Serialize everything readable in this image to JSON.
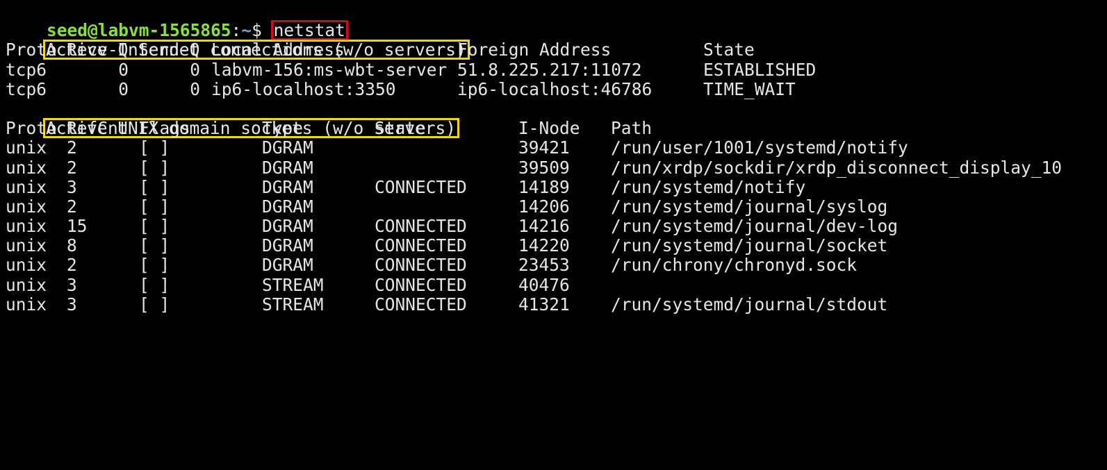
{
  "prompt": {
    "user_host": "seed@labvm-1565865",
    "separator": ":",
    "path": "~",
    "symbol": "$",
    "command": "netstat"
  },
  "inet": {
    "heading": "Active Internet connections (w/o servers)",
    "headers": [
      "Proto",
      "Recv-Q",
      "Send-Q",
      "Local Address",
      "Foreign Address",
      "State"
    ],
    "rows": [
      [
        "tcp6",
        "0",
        "0",
        "labvm-156:ms-wbt-server",
        "51.8.225.217:11072",
        "ESTABLISHED"
      ],
      [
        "tcp6",
        "0",
        "0",
        "ip6-localhost:3350",
        "ip6-localhost:46786",
        "TIME_WAIT"
      ]
    ]
  },
  "unix": {
    "heading": "Active UNIX domain sockets (w/o servers)",
    "headers": [
      "Proto",
      "RefCnt",
      "Flags",
      "Type",
      "State",
      "I-Node",
      "Path"
    ],
    "rows": [
      [
        "unix",
        "2",
        "[ ]",
        "DGRAM",
        "",
        "39421",
        "/run/user/1001/systemd/notify"
      ],
      [
        "unix",
        "2",
        "[ ]",
        "DGRAM",
        "",
        "39509",
        "/run/xrdp/sockdir/xrdp_disconnect_display_10"
      ],
      [
        "unix",
        "3",
        "[ ]",
        "DGRAM",
        "CONNECTED",
        "14189",
        "/run/systemd/notify"
      ],
      [
        "unix",
        "2",
        "[ ]",
        "DGRAM",
        "",
        "14206",
        "/run/systemd/journal/syslog"
      ],
      [
        "unix",
        "15",
        "[ ]",
        "DGRAM",
        "CONNECTED",
        "14216",
        "/run/systemd/journal/dev-log"
      ],
      [
        "unix",
        "8",
        "[ ]",
        "DGRAM",
        "CONNECTED",
        "14220",
        "/run/systemd/journal/socket"
      ],
      [
        "unix",
        "2",
        "[ ]",
        "DGRAM",
        "CONNECTED",
        "23453",
        "/run/chrony/chronyd.sock"
      ],
      [
        "unix",
        "3",
        "[ ]",
        "STREAM",
        "CONNECTED",
        "40476",
        ""
      ],
      [
        "unix",
        "3",
        "[ ]",
        "STREAM",
        "CONNECTED",
        "41321",
        "/run/systemd/journal/stdout"
      ]
    ]
  },
  "colors": {
    "background": "#000000",
    "text": "#e6e6e6",
    "prompt_user": "#8ae234",
    "prompt_path": "#729fcf",
    "command_highlight": "#e3001b",
    "heading_highlight": "#f4d900"
  }
}
